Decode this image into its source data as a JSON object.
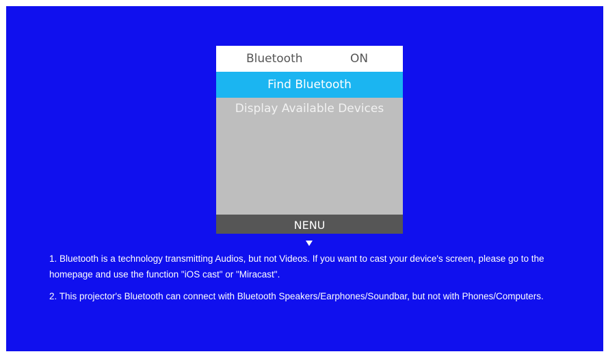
{
  "menu": {
    "header": {
      "label": "Bluetooth",
      "value": "ON"
    },
    "items": [
      {
        "label": "Find Bluetooth",
        "selected": true
      },
      {
        "label": "Display Available Devices",
        "selected": false
      }
    ],
    "footer_label": "NENU",
    "footer_arrow_icon": "triangle-down-icon"
  },
  "notes": [
    "1. Bluetooth is a technology transmitting Audios, but not Videos. If you want to cast your device's screen, please go to the homepage and use the function \"iOS cast\" or \"Miracast\".",
    "2. This projector's Bluetooth can connect with Bluetooth Speakers/Earphones/Soundbar, but not with Phones/Computers."
  ],
  "colors": {
    "background": "#1010ee",
    "panel": "#bebebe",
    "selected": "#1bb5f1",
    "footer": "#565656",
    "header": "#ffffff"
  }
}
